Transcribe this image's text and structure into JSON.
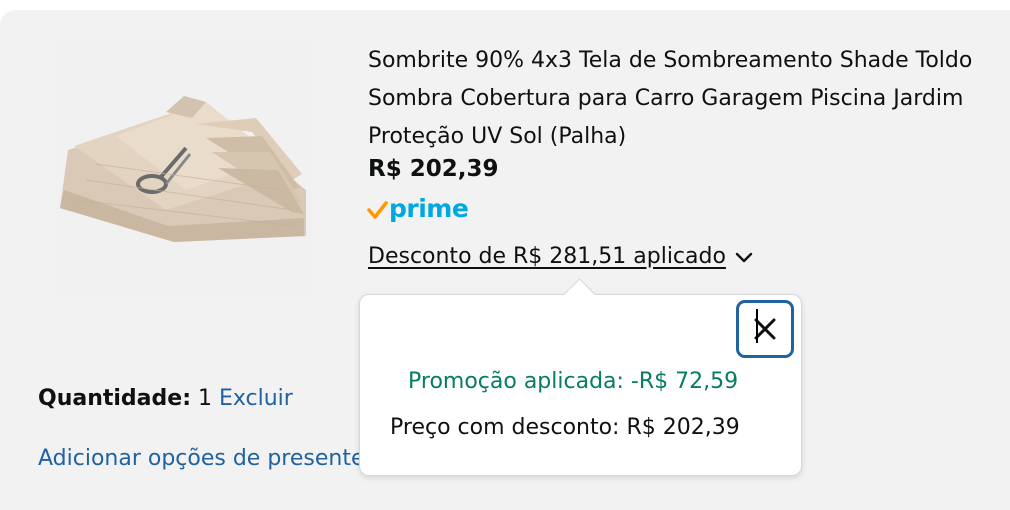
{
  "product": {
    "title": "Sombrite 90% 4x3 Tela de Sombreamento Shade Toldo Sombra Cobertura para Carro Garagem Piscina Jardim Proteção UV Sol (Palha)",
    "price": "R$ 202,39",
    "prime_label": "prime",
    "discount_label": "Desconto de R$ 281,51 aplicado",
    "image_icon": "folded-shade-cloth-image"
  },
  "quantity": {
    "label": "Quantidade:",
    "value": "1",
    "delete_link": "Excluir"
  },
  "gift_link": "Adicionar opções de presente",
  "popover": {
    "promo_text": "Promoção aplicada: -R$ 72,59",
    "final_price_text": "Preço com desconto: R$ 202,39",
    "close_icon": "close-icon"
  },
  "colors": {
    "link": "#2162a1",
    "prime_blue": "#00a8e1",
    "prime_check": "#ff9900",
    "promo_green": "#067d62",
    "panel_bg": "#f2f2f2"
  }
}
